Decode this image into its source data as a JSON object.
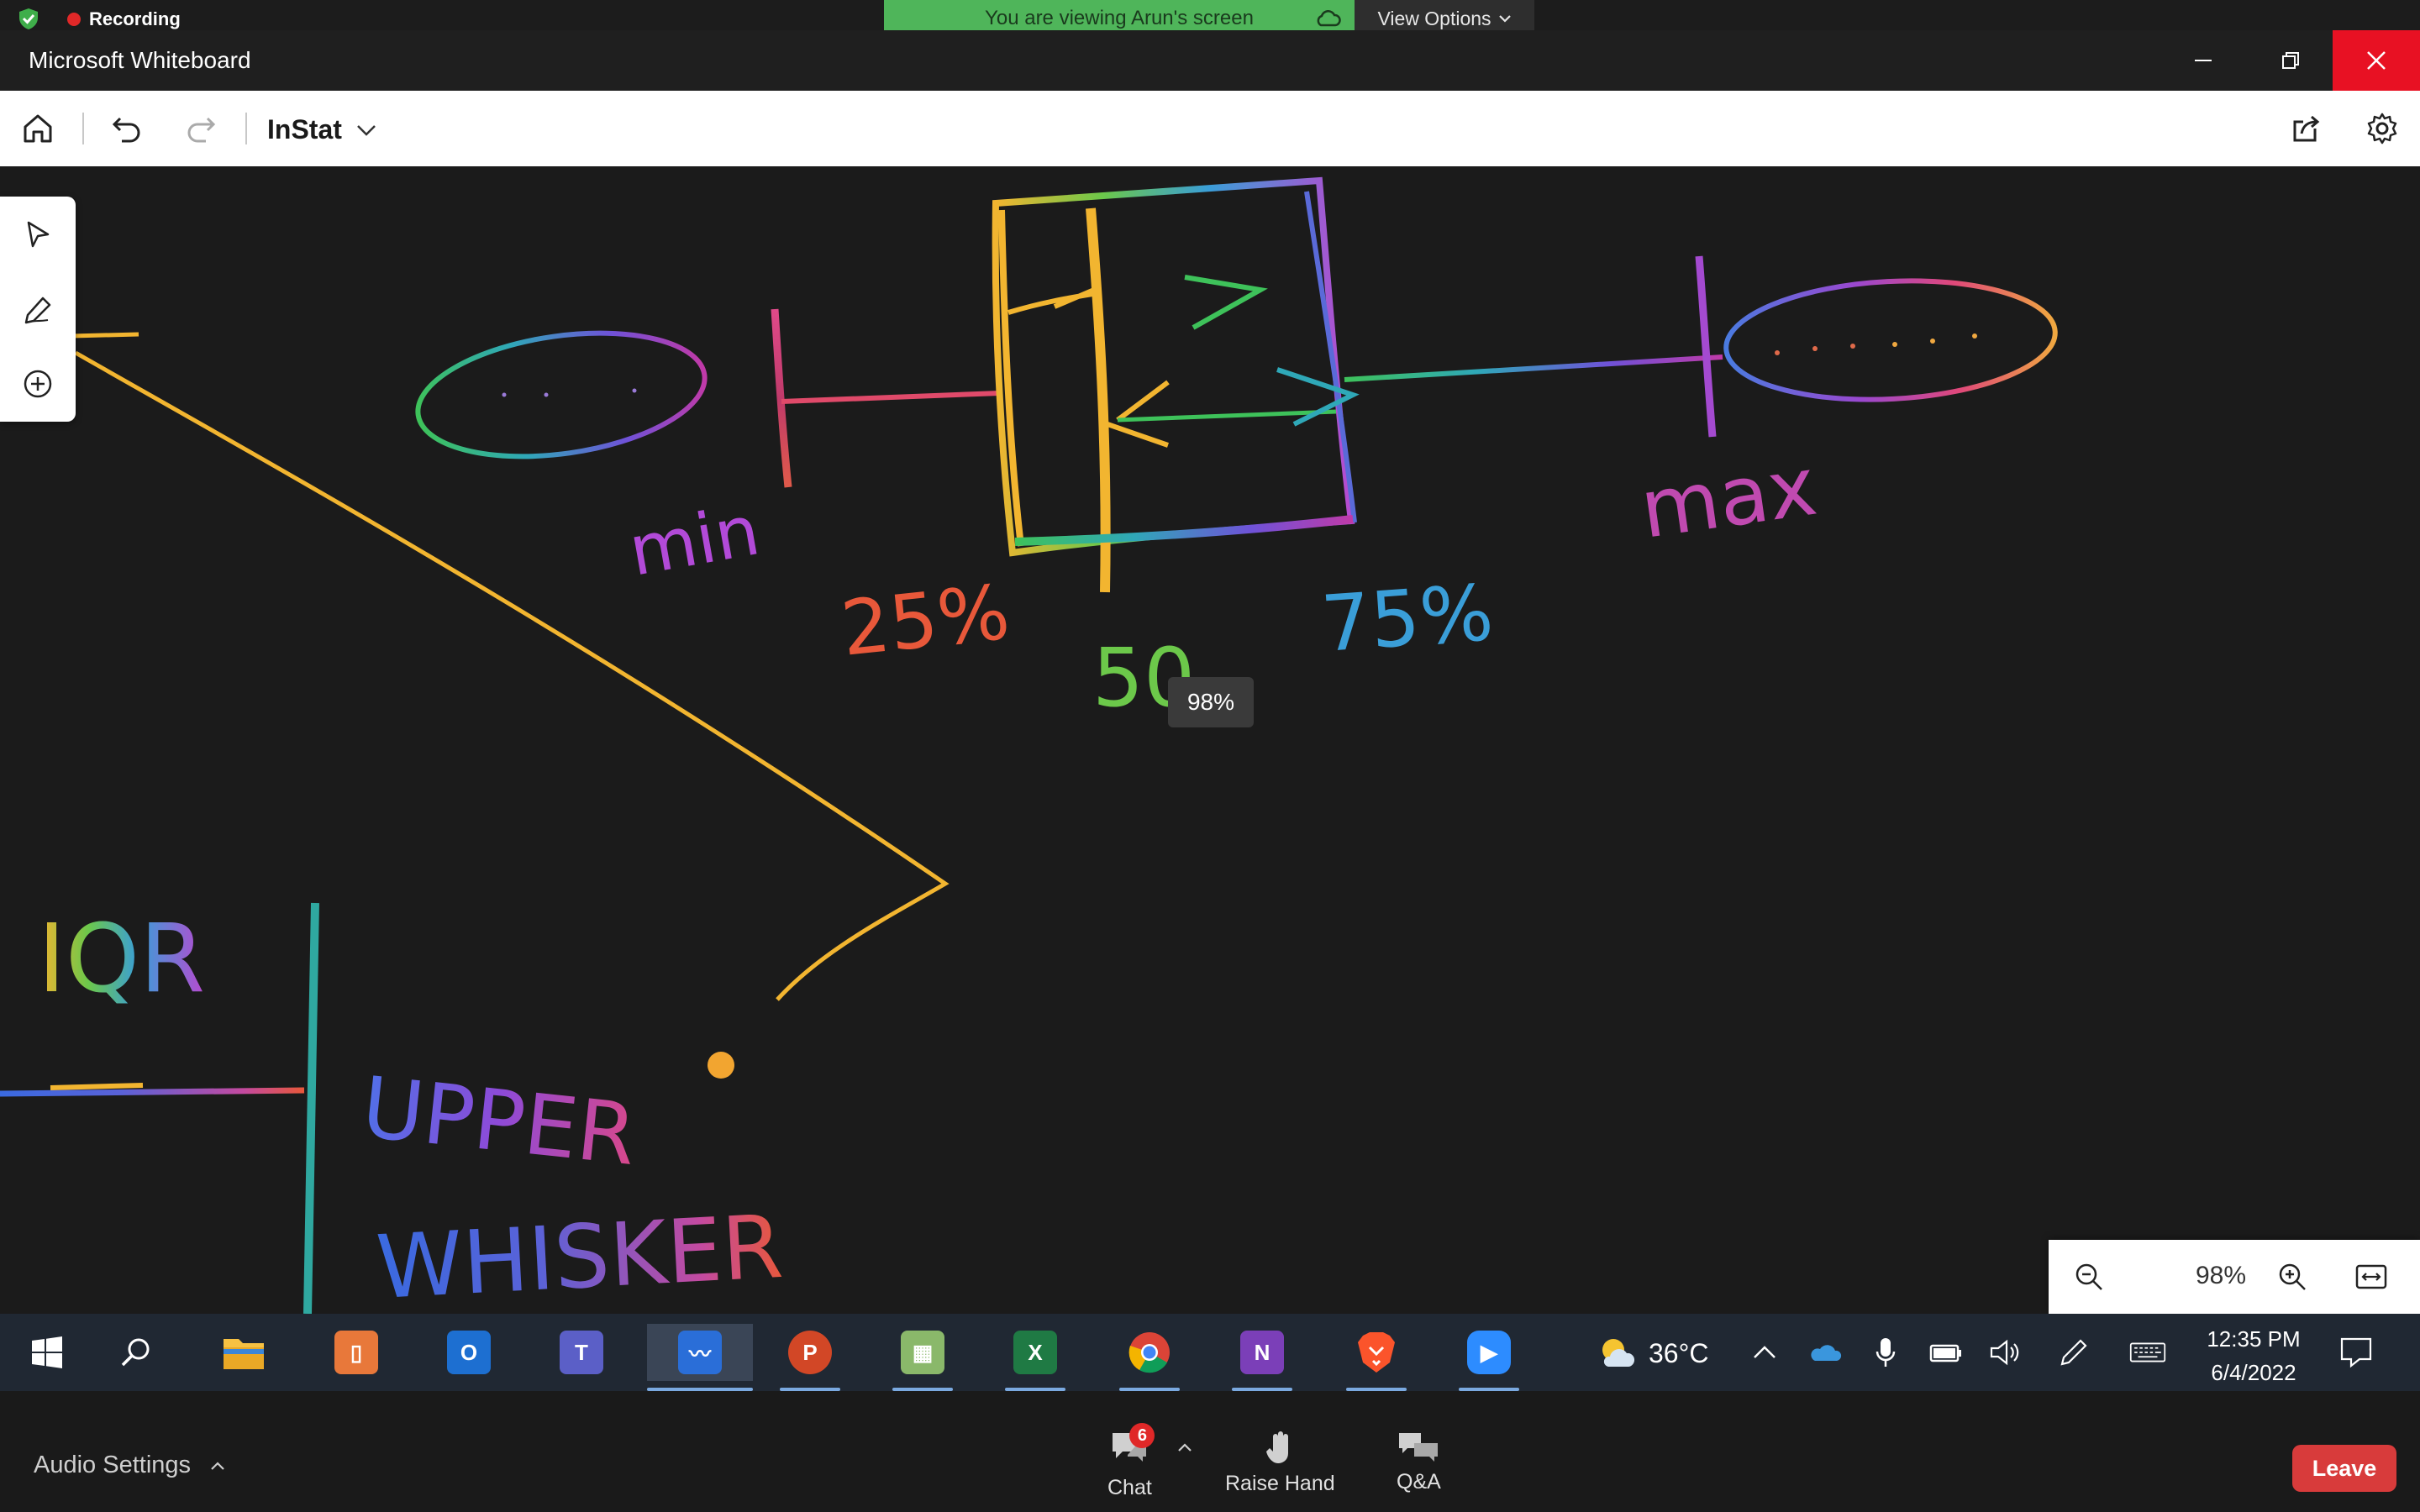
{
  "zoom_meeting": {
    "recording_label": "Recording",
    "viewing_banner": "You are viewing Arun's screen",
    "view_options_label": "View Options"
  },
  "window": {
    "title": "Microsoft Whiteboard"
  },
  "toolbar": {
    "board_name": "InStat"
  },
  "canvas": {
    "zoom_tooltip": "98%",
    "handwriting": [
      "min",
      "25%",
      "50",
      "75%",
      "max",
      "IQR",
      "UPPER",
      "WHISKER"
    ]
  },
  "zoom_panel": {
    "value": "98%"
  },
  "taskbar": {
    "apps": [
      "start",
      "search",
      "file-explorer",
      "app-orange",
      "outlook",
      "teams",
      "whiteboard",
      "powerpoint",
      "image-viewer",
      "excel",
      "chrome",
      "onenote",
      "brave",
      "zoom"
    ],
    "active_app": "whiteboard",
    "temperature": "36°C",
    "time": "12:35 PM",
    "date": "6/4/2022"
  },
  "meeting_controls": {
    "audio_settings_label": "Audio Settings",
    "chat_label": "Chat",
    "chat_badge": "6",
    "raise_hand_label": "Raise Hand",
    "qa_label": "Q&A",
    "leave_label": "Leave"
  },
  "colors": {
    "viewing_banner": "#4fb55a",
    "close_button": "#e81123",
    "leave_button": "#d83b3b",
    "taskbar": "#202833",
    "canvas": "#1b1b1b"
  }
}
